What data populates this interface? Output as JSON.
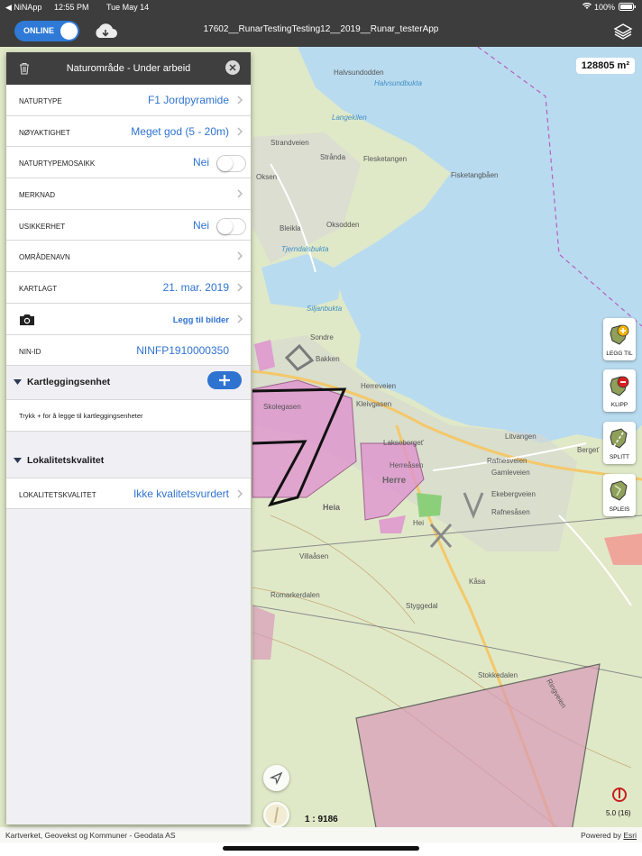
{
  "status": {
    "back_app": "◀ NiNApp",
    "time": "12:55 PM",
    "date": "Tue May 14",
    "battery": "100%"
  },
  "nav": {
    "online_label": "ONLINE",
    "title": "17602__RunarTestingTesting12__2019__Runar_testerApp"
  },
  "map": {
    "area": "128805 m²",
    "scale": "1 : 9186",
    "zoom": "5.0 (16)",
    "attribution": "Kartverket, Geovekst og Kommuner - Geodata AS",
    "powered": "Powered by",
    "esri": "Esri",
    "place_names": [
      "Halvsundodden",
      "Halvsundbukta",
      "Langekilen",
      "Strandveien",
      "Strånda",
      "Flesketangen",
      "Fisketangbåen",
      "Oksen",
      "Bleikla",
      "Oksodden",
      "Tjerndalsbukta",
      "Siljanbukta",
      "Sondre",
      "Bakken",
      "Herreveien",
      "Skolegasen",
      "Kleivgasen",
      "Laksebergeť",
      "Herreåsen",
      "Herre",
      "Heia",
      "Hei",
      "Rafnesveien",
      "Gamleveien",
      "Litvangen",
      "Bergeť",
      "Ekebergveien",
      "Rafnesåsen",
      "Villaåsen",
      "Romarkerdalen",
      "Kåsa",
      "Styggedal",
      "Stokkedalen",
      "Ringveien"
    ],
    "tools": [
      {
        "label": "LEGG TIL",
        "icon": "add-polygon-icon"
      },
      {
        "label": "KLIPP",
        "icon": "clip-polygon-icon"
      },
      {
        "label": "SPLITT",
        "icon": "split-polygon-icon"
      },
      {
        "label": "SPLEIS",
        "icon": "merge-polygon-icon"
      }
    ]
  },
  "panel": {
    "title": "Naturområde - Under arbeid",
    "rows": [
      {
        "key": "NATURTYPE",
        "value": "F1 Jordpyramide"
      },
      {
        "key": "NØYAKTIGHET",
        "value": "Meget god (5 - 20m)"
      },
      {
        "key": "NATURTYPEMOSAIKK",
        "value": "Nei"
      },
      {
        "key": "MERKNAD",
        "value": ""
      },
      {
        "key": "USIKKERHET",
        "value": "Nei"
      },
      {
        "key": "OMRÅDENAVN",
        "value": ""
      },
      {
        "key": "KARTLAGT",
        "value": "21. mar. 2019"
      },
      {
        "key": "",
        "value": "Legg til bilder"
      },
      {
        "key": "NIN-ID",
        "value": "NINFP1910000350"
      }
    ],
    "section1": {
      "title": "Kartleggingsenhet",
      "hint": "Trykk + for å legge til kartleggingsenheter"
    },
    "section2": {
      "title": "Lokalitetskvalitet",
      "row_key": "LOKALITETSKVALITET",
      "row_value": "Ikke kvalitetsvurdert"
    }
  },
  "colors": {
    "accent": "#2f73d0",
    "bar": "#3d3d3d",
    "water": "#b9dbef",
    "land": "#dfe9c8",
    "polygon": "#e08fd0"
  }
}
